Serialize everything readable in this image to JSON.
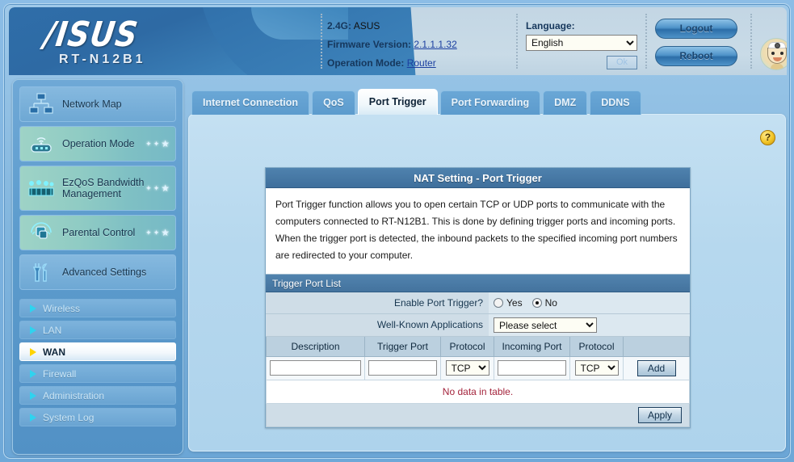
{
  "brand": {
    "logo_text": "/ISUS",
    "model": "RT-N12B1",
    "mascot_icon": "doctor-mascot-icon"
  },
  "header": {
    "band_label": "2.4G:",
    "band_value": "ASUS",
    "firmware_label": "Firmware Version:",
    "firmware_value": "2.1.1.1.32",
    "opmode_label": "Operation Mode:",
    "opmode_value": "Router",
    "language_label": "Language:",
    "language_selected": "English",
    "language_options": [
      "English"
    ],
    "ok_label": "Ok",
    "logout_label": "Logout",
    "reboot_label": "Reboot"
  },
  "sidebar": {
    "main_items": [
      {
        "label": "Network Map",
        "icon": "network-map-icon",
        "style": "plain",
        "stars": false
      },
      {
        "label": "Operation Mode",
        "icon": "router-signal-icon",
        "style": "green",
        "stars": true
      },
      {
        "label": "EzQoS Bandwidth Management",
        "icon": "bandwidth-bars-icon",
        "style": "green",
        "stars": true
      },
      {
        "label": "Parental Control",
        "icon": "parental-control-icon",
        "style": "green",
        "stars": true
      },
      {
        "label": "Advanced Settings",
        "icon": "tools-icon",
        "style": "plain",
        "stars": false
      }
    ],
    "sub_items": [
      {
        "label": "Wireless",
        "active": false
      },
      {
        "label": "LAN",
        "active": false
      },
      {
        "label": "WAN",
        "active": true
      },
      {
        "label": "Firewall",
        "active": false
      },
      {
        "label": "Administration",
        "active": false
      },
      {
        "label": "System Log",
        "active": false
      }
    ]
  },
  "tabs": [
    {
      "label": "Internet Connection",
      "active": false
    },
    {
      "label": "QoS",
      "active": false
    },
    {
      "label": "Port Trigger",
      "active": true
    },
    {
      "label": "Port Forwarding",
      "active": false
    },
    {
      "label": "DMZ",
      "active": false
    },
    {
      "label": "DDNS",
      "active": false
    }
  ],
  "help_icon_label": "?",
  "card": {
    "title": "NAT Setting - Port Trigger",
    "description": "Port Trigger function allows you to open certain TCP or UDP ports to communicate with the computers connected to RT-N12B1. This is done by defining trigger ports and incoming ports. When the trigger port is detected, the inbound packets to the specified incoming port numbers are redirected to your computer.",
    "list_header": "Trigger Port List",
    "enable_label": "Enable Port Trigger?",
    "radio_yes": "Yes",
    "radio_no": "No",
    "enable_value": "No",
    "wellknown_label": "Well-Known Applications",
    "wellknown_selected": "Please select",
    "wellknown_options": [
      "Please select"
    ],
    "columns": [
      "Description",
      "Trigger Port",
      "Protocol",
      "Incoming Port",
      "Protocol",
      ""
    ],
    "new_row": {
      "description": "",
      "trigger_port": "",
      "protocol_trigger": "TCP",
      "incoming_port": "",
      "protocol_incoming": "TCP",
      "protocol_options": [
        "TCP"
      ]
    },
    "add_label": "Add",
    "empty_text": "No data in table.",
    "apply_label": "Apply"
  },
  "colors": {
    "accent_blue": "#3f6f9c",
    "panel_blue": "#b6d8ee",
    "sidebar_blue": "#5d9ccd",
    "active_yellow": "#ffd400",
    "error_red": "#a4243c",
    "link_blue": "#1b3fa0"
  }
}
